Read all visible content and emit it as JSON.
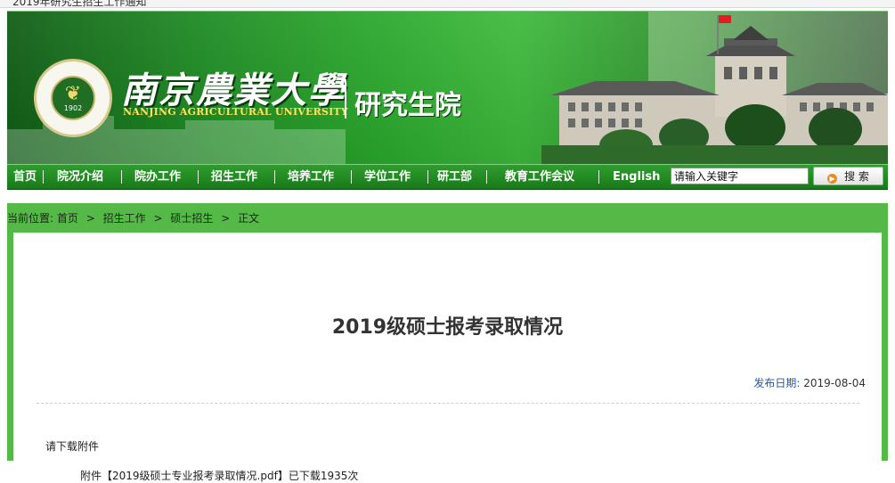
{
  "browser": {
    "tab_title": "2019年研究生招生工作通知"
  },
  "header": {
    "university_cn": "南京農業大學",
    "university_en": "NANJING AGRICULTURAL UNIVERSITY",
    "logo_year": "1902",
    "department": "研究生院"
  },
  "nav": {
    "items": [
      "首页",
      "院况介绍",
      "院办工作",
      "招生工作",
      "培养工作",
      "学位工作",
      "研工部",
      "教育工作会议",
      "English"
    ],
    "search_value": "请输入关键字",
    "search_button": "搜 索"
  },
  "breadcrumb": {
    "prefix": "当前位置:",
    "items": [
      "首页",
      "招生工作",
      "硕士招生",
      "正文"
    ],
    "separator": ">"
  },
  "article": {
    "title": "2019级硕士报考录取情况",
    "date_label": "发布日期:",
    "date_value": "2019-08-04",
    "intro": "请下载附件",
    "attachment_prefix": "附件",
    "attachment_link": "【2019级硕士专业报考录取情况.pdf】",
    "attachment_suffix": "已下载1935次"
  },
  "colors": {
    "banner_green": "#29a82b",
    "nav_green": "#177a19",
    "content_green": "#55b948",
    "date_label_blue": "#1e5aa8"
  }
}
